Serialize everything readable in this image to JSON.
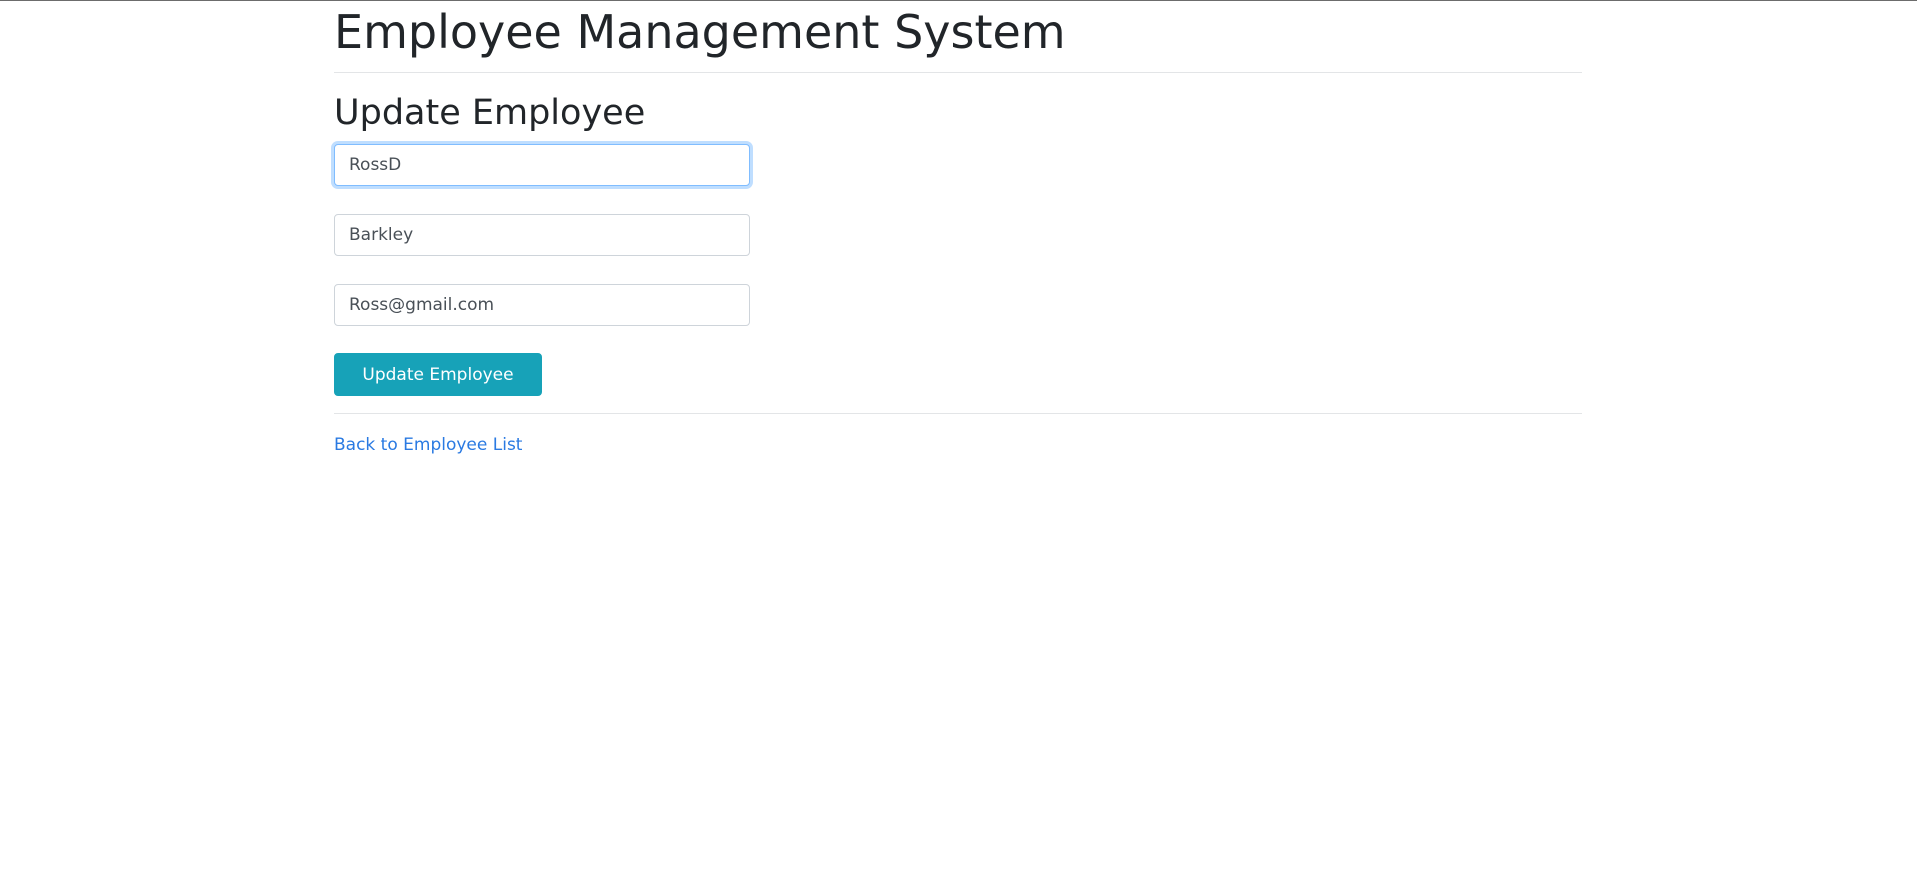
{
  "header": {
    "title": "Employee Management System"
  },
  "form": {
    "title": "Update Employee",
    "first_name": {
      "value": "RossD"
    },
    "last_name": {
      "value": "Barkley"
    },
    "email": {
      "value": "Ross@gmail.com"
    },
    "submit_label": "Update Employee"
  },
  "footer": {
    "back_link_label": "Back to Employee List"
  },
  "colors": {
    "button_bg": "#17a2b8",
    "link": "#2a7ae2",
    "focus_border": "#80bdff"
  }
}
